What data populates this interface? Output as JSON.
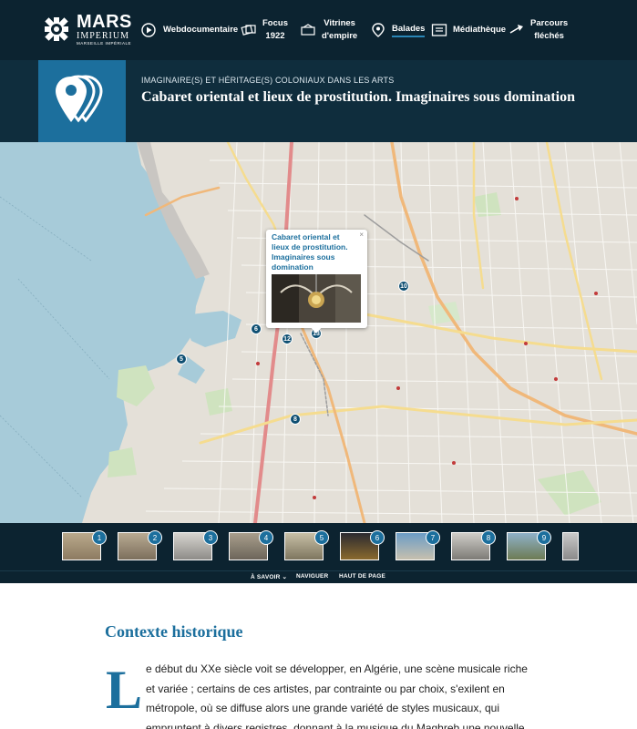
{
  "nav": {
    "logo": {
      "line1": "MARS",
      "line2": "IMPERIUM",
      "line3": "MARSEILLE IMPÉRIALE"
    },
    "items": [
      {
        "label": "Webdocumentaire",
        "icon": "play-icon"
      },
      {
        "label": "Focus\n1922",
        "icon": "cards-icon"
      },
      {
        "label": "Vitrines\nd'empire",
        "icon": "vitrine-icon"
      },
      {
        "label": "Balades",
        "icon": "map-pin-icon",
        "active": true
      },
      {
        "label": "Médiathèque",
        "icon": "media-icon"
      },
      {
        "label": "Parcours\nfléchés",
        "icon": "arrow-icon"
      }
    ]
  },
  "banner": {
    "kicker": "IMAGINAIRE(S) ET HÉRITAGE(S) COLONIAUX DANS LES ARTS",
    "title": "Cabaret oriental et lieux de prostitution. Imaginaires sous domination"
  },
  "map": {
    "markers": [
      "5",
      "6",
      "8",
      "10",
      "12",
      "13"
    ],
    "popup": {
      "title": "Cabaret oriental et lieux de prostitution. Imaginaires sous domination",
      "close": "×"
    }
  },
  "strip": {
    "items": [
      "1",
      "2",
      "3",
      "4",
      "5",
      "6",
      "7",
      "8",
      "9"
    ]
  },
  "subnav": {
    "a_savoir": "À SAVOIR ⌄",
    "naviguer": "NAVIGUER",
    "haut": "HAUT DE PAGE"
  },
  "content": {
    "heading": "Contexte historique",
    "dropcap": "L",
    "paragraph": "e début du XXe siècle voit se développer, en Algérie, une scène musicale riche et variée ; certains de ces artistes, par contrainte ou par choix, s'exilent en métropole, où se diffuse alors une grande variété de styles musicaux, qui empruntent à divers registres, donnant à la musique du Maghreb une nouvelle"
  },
  "colors": {
    "nav_bg": "#0c2330",
    "banner_bg": "#0f2d3d",
    "accent": "#1c6f9d",
    "sea": "#a7cbd9"
  }
}
